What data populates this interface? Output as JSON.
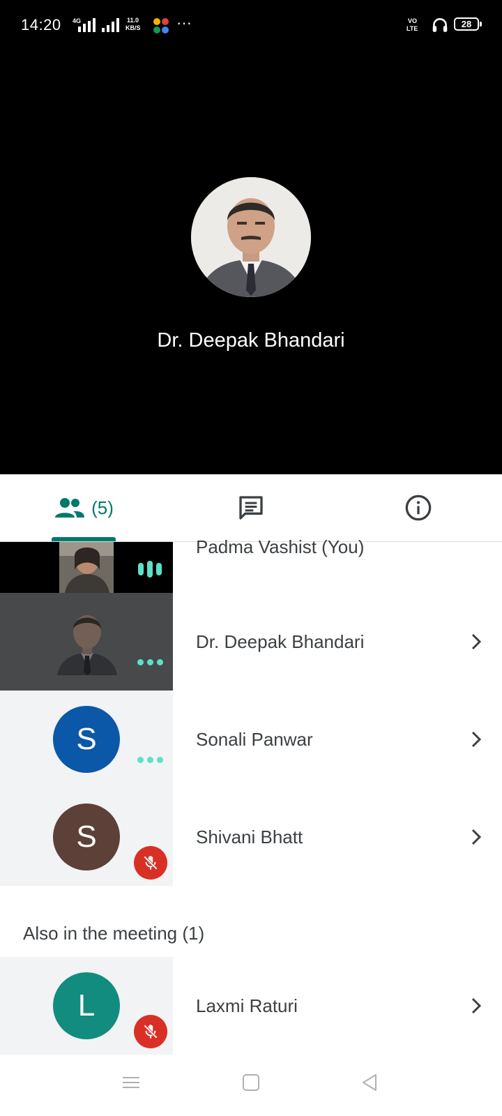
{
  "status_bar": {
    "time": "14:20",
    "network_gen": "4G",
    "data_speed_value": "11.0",
    "data_speed_unit": "KB/S",
    "volte_top": "VO",
    "volte_bottom": "LTE",
    "battery": "28"
  },
  "stage": {
    "speaker_name": "Dr. Deepak Bhandari"
  },
  "tabs": {
    "people_count": "(5)",
    "active": "people"
  },
  "participants": {
    "self_name": "Padma Vashist (You)",
    "rows": [
      {
        "name": "Dr. Deepak Bhandari",
        "status": "speaking-dots"
      },
      {
        "name": "Sonali Panwar",
        "initial": "S",
        "avatar_color": "#0b57a8",
        "status": "speaking-dots"
      },
      {
        "name": "Shivani Bhatt",
        "initial": "S",
        "avatar_color": "#5d4037",
        "status": "muted"
      }
    ]
  },
  "also_in_meeting": {
    "header": "Also in the meeting (1)",
    "rows": [
      {
        "name": "Laxmi Raturi",
        "initial": "L",
        "avatar_color": "#128c7e",
        "status": "muted"
      }
    ]
  },
  "colors": {
    "accent": "#00796b",
    "indicator": "#5ce1c9",
    "mute_red": "#d93025"
  }
}
